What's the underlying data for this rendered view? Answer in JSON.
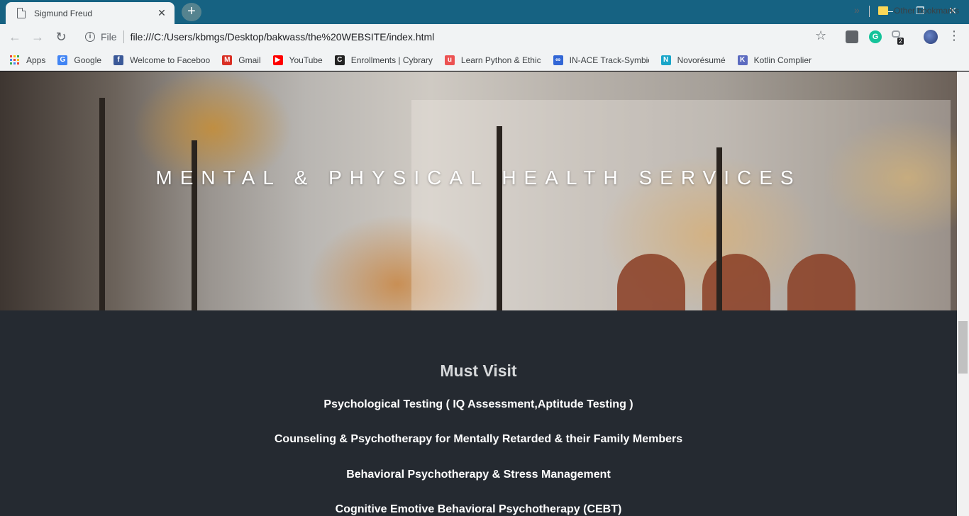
{
  "browser": {
    "tab_title": "Sigmund Freud",
    "tab_close": "✕",
    "new_tab": "+",
    "window_controls": {
      "minimize": "—",
      "restore": "❐",
      "close": "✕"
    },
    "scheme_label": "File",
    "url": "file:///C:/Users/kbmgs/Desktop/bakwass/the%20WEBSITE/index.html",
    "extensions": {
      "grammarly": "G",
      "badge_count": "2"
    },
    "bookmarks": [
      {
        "label": "Apps",
        "icon": "apps-grid-icon"
      },
      {
        "label": "Google",
        "icon": "google-icon",
        "color": "#4285f4",
        "glyph": "G"
      },
      {
        "label": "Welcome to Faceboo",
        "icon": "facebook-icon",
        "color": "#3b5998",
        "glyph": "f"
      },
      {
        "label": "Gmail",
        "icon": "gmail-icon",
        "color": "#d93025",
        "glyph": "M"
      },
      {
        "label": "YouTube",
        "icon": "youtube-icon",
        "color": "#ff0000",
        "glyph": "▶"
      },
      {
        "label": "Enrollments | Cybrary",
        "icon": "cybrary-icon",
        "color": "#222222",
        "glyph": "C"
      },
      {
        "label": "Learn Python & Ethic",
        "icon": "udemy-icon",
        "color": "#ec5252",
        "glyph": "u"
      },
      {
        "label": "IN-ACE Track-Symbio",
        "icon": "link-icon",
        "color": "#3367d6",
        "glyph": "∞"
      },
      {
        "label": "Novorésumé",
        "icon": "novoresume-icon",
        "color": "#1aa6c9",
        "glyph": "N"
      },
      {
        "label": "Kotlin Complier",
        "icon": "kotlin-icon",
        "color": "#5c6bc0",
        "glyph": "K"
      }
    ],
    "bookmarks_more": "»",
    "other_bookmarks": "Other bookmarks"
  },
  "page": {
    "hero_title": "MENTAL & PHYSICAL HEALTH SERVICES",
    "section_heading": "Must Visit",
    "services": [
      "Psychological Testing ( IQ Assessment,Aptitude Testing )",
      "Counseling & Psychotherapy for Mentally Retarded & their Family Members",
      "Behavioral Psychotherapy & Stress Management",
      "Cognitive Emotive Behavioral Psychotherapy (CEBT)"
    ]
  },
  "colors": {
    "titlebar": "#166282",
    "content_bg": "#252a31",
    "heading": "#d6d8da",
    "service_text": "#ffffff"
  }
}
